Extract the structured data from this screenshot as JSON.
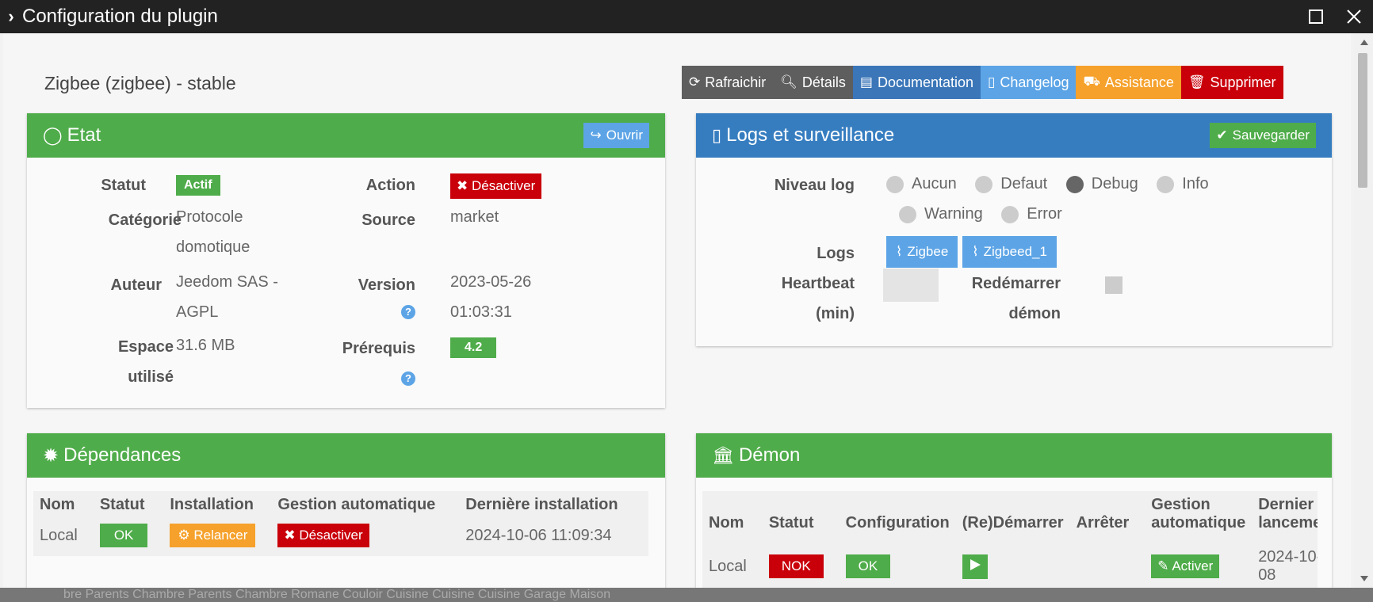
{
  "window": {
    "title": "Configuration du plugin"
  },
  "plugin": {
    "name": "Zigbee (zigbee) - stable"
  },
  "toolbar": {
    "refresh": "Rafraichir",
    "details": "Détails",
    "documentation": "Documentation",
    "changelog": "Changelog",
    "assistance": "Assistance",
    "delete": "Supprimer"
  },
  "etat": {
    "title": "Etat",
    "open_label": "Ouvrir",
    "statut_label": "Statut",
    "statut_value": "Actif",
    "action_label": "Action",
    "action_button": "Désactiver",
    "categorie_label": "Catégorie",
    "categorie_value_1": "Protocole",
    "categorie_value_2": "domotique",
    "source_label": "Source",
    "source_value": "market",
    "auteur_label": "Auteur",
    "auteur_value_1": "Jeedom SAS -",
    "auteur_value_2": "AGPL",
    "version_label": "Version",
    "version_value_1": "2023-05-26",
    "version_value_2": "01:03:31",
    "espace_label_1": "Espace",
    "espace_label_2": "utilisé",
    "espace_value": "31.6 MB",
    "prerequis_label": "Prérequis",
    "prerequis_value": "4.2",
    "help": "?"
  },
  "logs": {
    "title": "Logs et surveillance",
    "save_label": "Sauvegarder",
    "niveau_label": "Niveau log",
    "levels": [
      "Aucun",
      "Defaut",
      "Debug",
      "Info",
      "Warning",
      "Error"
    ],
    "selected_level": "Debug",
    "logs_label": "Logs",
    "log_buttons": [
      "Zigbee",
      "Zigbeed_1"
    ],
    "heartbeat_label_1": "Heartbeat",
    "heartbeat_label_2": "(min)",
    "heartbeat_value": "",
    "restart_label_1": "Redémarrer",
    "restart_label_2": "démon"
  },
  "dependances": {
    "title": "Dépendances",
    "headers": [
      "Nom",
      "Statut",
      "Installation",
      "Gestion automatique",
      "Dernière installation"
    ],
    "row": {
      "nom": "Local",
      "statut": "OK",
      "installation": "Relancer",
      "gestion": "Désactiver",
      "derniere": "2024-10-06 11:09:34"
    }
  },
  "demon": {
    "title": "Démon",
    "headers": [
      "Nom",
      "Statut",
      "Configuration",
      "(Re)Démarrer",
      "Arrêter",
      "Gestion automatique",
      "Dernier lancement"
    ],
    "row": {
      "nom": "Local",
      "statut": "NOK",
      "configuration": "OK",
      "gestion": "Activer",
      "dernier": "2024-10-08"
    }
  },
  "bottom_bar": "bre Parents      Chambre Parents      Chambre Romane      Couloir      Cuisine      Cuisine      Cuisine      Garage      Maison"
}
